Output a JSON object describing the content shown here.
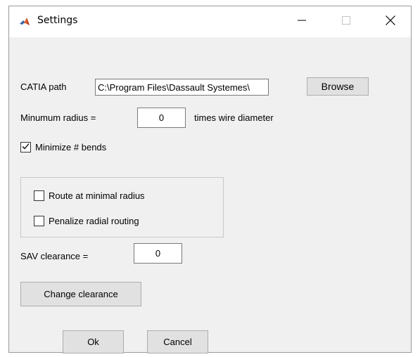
{
  "window": {
    "title": "Settings"
  },
  "catia": {
    "label": "CATIA path",
    "value": "C:\\Program Files\\Dassault Systemes\\",
    "browse_label": "Browse"
  },
  "radius": {
    "label": "Minumum radius =",
    "value": "0",
    "suffix": "times wire diameter"
  },
  "minimize_bends": {
    "label": "Minimize # bends",
    "checked": true
  },
  "group": {
    "route_minimal": {
      "label": "Route at minimal radius",
      "checked": false
    },
    "penalize_radial": {
      "label": "Penalize radial routing",
      "checked": false
    }
  },
  "sav": {
    "label": "SAV clearance =",
    "value": "0"
  },
  "change_clearance_label": "Change clearance",
  "ok_label": "Ok",
  "cancel_label": "Cancel",
  "icons": {
    "app": "matlab-icon",
    "minimize": "minimize-icon",
    "maximize": "maximize-icon",
    "close": "close-icon",
    "check": "check-icon"
  }
}
